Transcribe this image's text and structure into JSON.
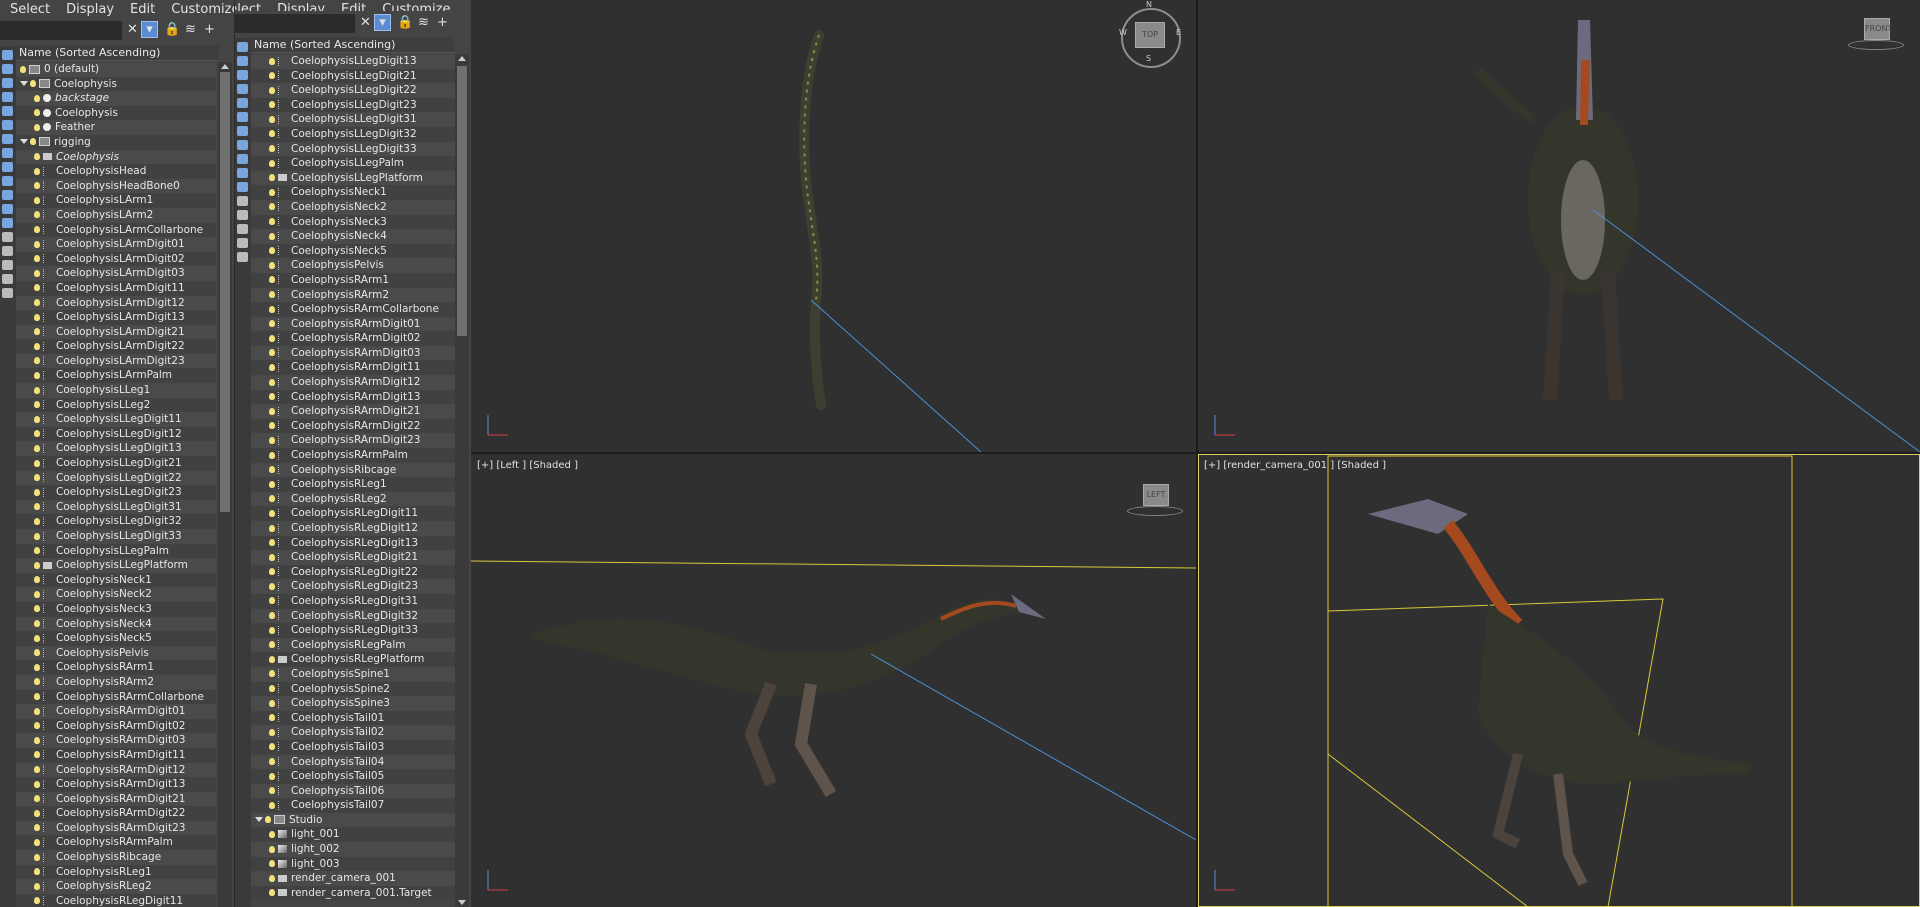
{
  "explorer1": {
    "menu": [
      "Select",
      "Display",
      "Edit",
      "Customize"
    ],
    "column_header": "Name (Sorted Ascending)",
    "rows": [
      {
        "label": "0 (default)",
        "indent": 0,
        "type": "layer",
        "arrow": false,
        "italic": false
      },
      {
        "label": "Coelophysis",
        "indent": 0,
        "type": "layer",
        "arrow": true,
        "italic": false
      },
      {
        "label": "backstage",
        "indent": 1,
        "type": "circle",
        "arrow": false,
        "italic": true
      },
      {
        "label": "Coelophysis",
        "indent": 1,
        "type": "circle",
        "arrow": false,
        "italic": false
      },
      {
        "label": "Feather",
        "indent": 1,
        "type": "circle",
        "arrow": false,
        "italic": false
      },
      {
        "label": "rigging",
        "indent": 0,
        "type": "layer",
        "arrow": true,
        "italic": false
      },
      {
        "label": "Coelophysis",
        "indent": 1,
        "type": "cam",
        "arrow": false,
        "italic": true
      },
      {
        "label": "CoelophysisHead",
        "indent": 1,
        "type": "bone",
        "arrow": false,
        "italic": false
      },
      {
        "label": "CoelophysisHeadBone0",
        "indent": 1,
        "type": "bone",
        "arrow": false,
        "italic": false
      },
      {
        "label": "CoelophysisLArm1",
        "indent": 1,
        "type": "bone",
        "arrow": false,
        "italic": false
      },
      {
        "label": "CoelophysisLArm2",
        "indent": 1,
        "type": "bone",
        "arrow": false,
        "italic": false
      },
      {
        "label": "CoelophysisLArmCollarbone",
        "indent": 1,
        "type": "bone",
        "arrow": false,
        "italic": false
      },
      {
        "label": "CoelophysisLArmDigit01",
        "indent": 1,
        "type": "bone",
        "arrow": false,
        "italic": false
      },
      {
        "label": "CoelophysisLArmDigit02",
        "indent": 1,
        "type": "bone",
        "arrow": false,
        "italic": false
      },
      {
        "label": "CoelophysisLArmDigit03",
        "indent": 1,
        "type": "bone",
        "arrow": false,
        "italic": false
      },
      {
        "label": "CoelophysisLArmDigit11",
        "indent": 1,
        "type": "bone",
        "arrow": false,
        "italic": false
      },
      {
        "label": "CoelophysisLArmDigit12",
        "indent": 1,
        "type": "bone",
        "arrow": false,
        "italic": false
      },
      {
        "label": "CoelophysisLArmDigit13",
        "indent": 1,
        "type": "bone",
        "arrow": false,
        "italic": false
      },
      {
        "label": "CoelophysisLArmDigit21",
        "indent": 1,
        "type": "bone",
        "arrow": false,
        "italic": false
      },
      {
        "label": "CoelophysisLArmDigit22",
        "indent": 1,
        "type": "bone",
        "arrow": false,
        "italic": false
      },
      {
        "label": "CoelophysisLArmDigit23",
        "indent": 1,
        "type": "bone",
        "arrow": false,
        "italic": false
      },
      {
        "label": "CoelophysisLArmPalm",
        "indent": 1,
        "type": "bone",
        "arrow": false,
        "italic": false
      },
      {
        "label": "CoelophysisLLeg1",
        "indent": 1,
        "type": "bone",
        "arrow": false,
        "italic": false
      },
      {
        "label": "CoelophysisLLeg2",
        "indent": 1,
        "type": "bone",
        "arrow": false,
        "italic": false
      },
      {
        "label": "CoelophysisLLegDigit11",
        "indent": 1,
        "type": "bone",
        "arrow": false,
        "italic": false
      },
      {
        "label": "CoelophysisLLegDigit12",
        "indent": 1,
        "type": "bone",
        "arrow": false,
        "italic": false
      },
      {
        "label": "CoelophysisLLegDigit13",
        "indent": 1,
        "type": "bone",
        "arrow": false,
        "italic": false
      },
      {
        "label": "CoelophysisLLegDigit21",
        "indent": 1,
        "type": "bone",
        "arrow": false,
        "italic": false
      },
      {
        "label": "CoelophysisLLegDigit22",
        "indent": 1,
        "type": "bone",
        "arrow": false,
        "italic": false
      },
      {
        "label": "CoelophysisLLegDigit23",
        "indent": 1,
        "type": "bone",
        "arrow": false,
        "italic": false
      },
      {
        "label": "CoelophysisLLegDigit31",
        "indent": 1,
        "type": "bone",
        "arrow": false,
        "italic": false
      },
      {
        "label": "CoelophysisLLegDigit32",
        "indent": 1,
        "type": "bone",
        "arrow": false,
        "italic": false
      },
      {
        "label": "CoelophysisLLegDigit33",
        "indent": 1,
        "type": "bone",
        "arrow": false,
        "italic": false
      },
      {
        "label": "CoelophysisLLegPalm",
        "indent": 1,
        "type": "bone",
        "arrow": false,
        "italic": false
      },
      {
        "label": "CoelophysisLLegPlatform",
        "indent": 1,
        "type": "cam",
        "arrow": false,
        "italic": false
      },
      {
        "label": "CoelophysisNeck1",
        "indent": 1,
        "type": "bone",
        "arrow": false,
        "italic": false
      },
      {
        "label": "CoelophysisNeck2",
        "indent": 1,
        "type": "bone",
        "arrow": false,
        "italic": false
      },
      {
        "label": "CoelophysisNeck3",
        "indent": 1,
        "type": "bone",
        "arrow": false,
        "italic": false
      },
      {
        "label": "CoelophysisNeck4",
        "indent": 1,
        "type": "bone",
        "arrow": false,
        "italic": false
      },
      {
        "label": "CoelophysisNeck5",
        "indent": 1,
        "type": "bone",
        "arrow": false,
        "italic": false
      },
      {
        "label": "CoelophysisPelvis",
        "indent": 1,
        "type": "bone",
        "arrow": false,
        "italic": false
      },
      {
        "label": "CoelophysisRArm1",
        "indent": 1,
        "type": "bone",
        "arrow": false,
        "italic": false
      },
      {
        "label": "CoelophysisRArm2",
        "indent": 1,
        "type": "bone",
        "arrow": false,
        "italic": false
      },
      {
        "label": "CoelophysisRArmCollarbone",
        "indent": 1,
        "type": "bone",
        "arrow": false,
        "italic": false
      },
      {
        "label": "CoelophysisRArmDigit01",
        "indent": 1,
        "type": "bone",
        "arrow": false,
        "italic": false
      },
      {
        "label": "CoelophysisRArmDigit02",
        "indent": 1,
        "type": "bone",
        "arrow": false,
        "italic": false
      },
      {
        "label": "CoelophysisRArmDigit03",
        "indent": 1,
        "type": "bone",
        "arrow": false,
        "italic": false
      },
      {
        "label": "CoelophysisRArmDigit11",
        "indent": 1,
        "type": "bone",
        "arrow": false,
        "italic": false
      },
      {
        "label": "CoelophysisRArmDigit12",
        "indent": 1,
        "type": "bone",
        "arrow": false,
        "italic": false
      },
      {
        "label": "CoelophysisRArmDigit13",
        "indent": 1,
        "type": "bone",
        "arrow": false,
        "italic": false
      },
      {
        "label": "CoelophysisRArmDigit21",
        "indent": 1,
        "type": "bone",
        "arrow": false,
        "italic": false
      },
      {
        "label": "CoelophysisRArmDigit22",
        "indent": 1,
        "type": "bone",
        "arrow": false,
        "italic": false
      },
      {
        "label": "CoelophysisRArmDigit23",
        "indent": 1,
        "type": "bone",
        "arrow": false,
        "italic": false
      },
      {
        "label": "CoelophysisRArmPalm",
        "indent": 1,
        "type": "bone",
        "arrow": false,
        "italic": false
      },
      {
        "label": "CoelophysisRibcage",
        "indent": 1,
        "type": "bone",
        "arrow": false,
        "italic": false
      },
      {
        "label": "CoelophysisRLeg1",
        "indent": 1,
        "type": "bone",
        "arrow": false,
        "italic": false
      },
      {
        "label": "CoelophysisRLeg2",
        "indent": 1,
        "type": "bone",
        "arrow": false,
        "italic": false
      },
      {
        "label": "CoelophysisRLegDigit11",
        "indent": 1,
        "type": "bone",
        "arrow": false,
        "italic": false
      }
    ]
  },
  "explorer2": {
    "menu": [
      "Select",
      "Display",
      "Edit",
      "Customize"
    ],
    "column_header": "Name (Sorted Ascending)",
    "rows": [
      {
        "label": "CoelophysisLLegDigit13",
        "indent": 1,
        "type": "bone",
        "arrow": false,
        "italic": false
      },
      {
        "label": "CoelophysisLLegDigit21",
        "indent": 1,
        "type": "bone",
        "arrow": false,
        "italic": false
      },
      {
        "label": "CoelophysisLLegDigit22",
        "indent": 1,
        "type": "bone",
        "arrow": false,
        "italic": false
      },
      {
        "label": "CoelophysisLLegDigit23",
        "indent": 1,
        "type": "bone",
        "arrow": false,
        "italic": false
      },
      {
        "label": "CoelophysisLLegDigit31",
        "indent": 1,
        "type": "bone",
        "arrow": false,
        "italic": false
      },
      {
        "label": "CoelophysisLLegDigit32",
        "indent": 1,
        "type": "bone",
        "arrow": false,
        "italic": false
      },
      {
        "label": "CoelophysisLLegDigit33",
        "indent": 1,
        "type": "bone",
        "arrow": false,
        "italic": false
      },
      {
        "label": "CoelophysisLLegPalm",
        "indent": 1,
        "type": "bone",
        "arrow": false,
        "italic": false
      },
      {
        "label": "CoelophysisLLegPlatform",
        "indent": 1,
        "type": "cam",
        "arrow": false,
        "italic": false
      },
      {
        "label": "CoelophysisNeck1",
        "indent": 1,
        "type": "bone",
        "arrow": false,
        "italic": false
      },
      {
        "label": "CoelophysisNeck2",
        "indent": 1,
        "type": "bone",
        "arrow": false,
        "italic": false
      },
      {
        "label": "CoelophysisNeck3",
        "indent": 1,
        "type": "bone",
        "arrow": false,
        "italic": false
      },
      {
        "label": "CoelophysisNeck4",
        "indent": 1,
        "type": "bone",
        "arrow": false,
        "italic": false
      },
      {
        "label": "CoelophysisNeck5",
        "indent": 1,
        "type": "bone",
        "arrow": false,
        "italic": false
      },
      {
        "label": "CoelophysisPelvis",
        "indent": 1,
        "type": "bone",
        "arrow": false,
        "italic": false
      },
      {
        "label": "CoelophysisRArm1",
        "indent": 1,
        "type": "bone",
        "arrow": false,
        "italic": false
      },
      {
        "label": "CoelophysisRArm2",
        "indent": 1,
        "type": "bone",
        "arrow": false,
        "italic": false
      },
      {
        "label": "CoelophysisRArmCollarbone",
        "indent": 1,
        "type": "bone",
        "arrow": false,
        "italic": false
      },
      {
        "label": "CoelophysisRArmDigit01",
        "indent": 1,
        "type": "bone",
        "arrow": false,
        "italic": false
      },
      {
        "label": "CoelophysisRArmDigit02",
        "indent": 1,
        "type": "bone",
        "arrow": false,
        "italic": false
      },
      {
        "label": "CoelophysisRArmDigit03",
        "indent": 1,
        "type": "bone",
        "arrow": false,
        "italic": false
      },
      {
        "label": "CoelophysisRArmDigit11",
        "indent": 1,
        "type": "bone",
        "arrow": false,
        "italic": false
      },
      {
        "label": "CoelophysisRArmDigit12",
        "indent": 1,
        "type": "bone",
        "arrow": false,
        "italic": false
      },
      {
        "label": "CoelophysisRArmDigit13",
        "indent": 1,
        "type": "bone",
        "arrow": false,
        "italic": false
      },
      {
        "label": "CoelophysisRArmDigit21",
        "indent": 1,
        "type": "bone",
        "arrow": false,
        "italic": false
      },
      {
        "label": "CoelophysisRArmDigit22",
        "indent": 1,
        "type": "bone",
        "arrow": false,
        "italic": false
      },
      {
        "label": "CoelophysisRArmDigit23",
        "indent": 1,
        "type": "bone",
        "arrow": false,
        "italic": false
      },
      {
        "label": "CoelophysisRArmPalm",
        "indent": 1,
        "type": "bone",
        "arrow": false,
        "italic": false
      },
      {
        "label": "CoelophysisRibcage",
        "indent": 1,
        "type": "bone",
        "arrow": false,
        "italic": false
      },
      {
        "label": "CoelophysisRLeg1",
        "indent": 1,
        "type": "bone",
        "arrow": false,
        "italic": false
      },
      {
        "label": "CoelophysisRLeg2",
        "indent": 1,
        "type": "bone",
        "arrow": false,
        "italic": false
      },
      {
        "label": "CoelophysisRLegDigit11",
        "indent": 1,
        "type": "bone",
        "arrow": false,
        "italic": false
      },
      {
        "label": "CoelophysisRLegDigit12",
        "indent": 1,
        "type": "bone",
        "arrow": false,
        "italic": false
      },
      {
        "label": "CoelophysisRLegDigit13",
        "indent": 1,
        "type": "bone",
        "arrow": false,
        "italic": false
      },
      {
        "label": "CoelophysisRLegDigit21",
        "indent": 1,
        "type": "bone",
        "arrow": false,
        "italic": false
      },
      {
        "label": "CoelophysisRLegDigit22",
        "indent": 1,
        "type": "bone",
        "arrow": false,
        "italic": false
      },
      {
        "label": "CoelophysisRLegDigit23",
        "indent": 1,
        "type": "bone",
        "arrow": false,
        "italic": false
      },
      {
        "label": "CoelophysisRLegDigit31",
        "indent": 1,
        "type": "bone",
        "arrow": false,
        "italic": false
      },
      {
        "label": "CoelophysisRLegDigit32",
        "indent": 1,
        "type": "bone",
        "arrow": false,
        "italic": false
      },
      {
        "label": "CoelophysisRLegDigit33",
        "indent": 1,
        "type": "bone",
        "arrow": false,
        "italic": false
      },
      {
        "label": "CoelophysisRLegPalm",
        "indent": 1,
        "type": "bone",
        "arrow": false,
        "italic": false
      },
      {
        "label": "CoelophysisRLegPlatform",
        "indent": 1,
        "type": "cam",
        "arrow": false,
        "italic": false
      },
      {
        "label": "CoelophysisSpine1",
        "indent": 1,
        "type": "bone",
        "arrow": false,
        "italic": false
      },
      {
        "label": "CoelophysisSpine2",
        "indent": 1,
        "type": "bone",
        "arrow": false,
        "italic": false
      },
      {
        "label": "CoelophysisSpine3",
        "indent": 1,
        "type": "bone",
        "arrow": false,
        "italic": false
      },
      {
        "label": "CoelophysisTail01",
        "indent": 1,
        "type": "bone",
        "arrow": false,
        "italic": false
      },
      {
        "label": "CoelophysisTail02",
        "indent": 1,
        "type": "bone",
        "arrow": false,
        "italic": false
      },
      {
        "label": "CoelophysisTail03",
        "indent": 1,
        "type": "bone",
        "arrow": false,
        "italic": false
      },
      {
        "label": "CoelophysisTail04",
        "indent": 1,
        "type": "bone",
        "arrow": false,
        "italic": false
      },
      {
        "label": "CoelophysisTail05",
        "indent": 1,
        "type": "bone",
        "arrow": false,
        "italic": false
      },
      {
        "label": "CoelophysisTail06",
        "indent": 1,
        "type": "bone",
        "arrow": false,
        "italic": false
      },
      {
        "label": "CoelophysisTail07",
        "indent": 1,
        "type": "bone",
        "arrow": false,
        "italic": false
      },
      {
        "label": "Studio",
        "indent": 0,
        "type": "layer",
        "arrow": true,
        "italic": false
      },
      {
        "label": "light_001",
        "indent": 1,
        "type": "light",
        "arrow": false,
        "italic": false
      },
      {
        "label": "light_002",
        "indent": 1,
        "type": "light",
        "arrow": false,
        "italic": false
      },
      {
        "label": "light_003",
        "indent": 1,
        "type": "light",
        "arrow": false,
        "italic": false
      },
      {
        "label": "render_camera_001",
        "indent": 1,
        "type": "cam",
        "arrow": false,
        "italic": false
      },
      {
        "label": "render_camera_001.Target",
        "indent": 1,
        "type": "cam",
        "arrow": false,
        "italic": false
      }
    ]
  },
  "viewports": {
    "top": {
      "navcube": "TOP",
      "compass": [
        "N",
        "E",
        "S",
        "W"
      ]
    },
    "front": {
      "navcube": "FRONT"
    },
    "left": {
      "label": "[+] [Left ] [Shaded ]",
      "navcube": "LEFT"
    },
    "camera": {
      "label": "[+] [render_camera_001 ] [Shaded ]"
    }
  },
  "colors": {
    "selection_line": "#4a90d9",
    "camera_frustum": "#d8c93a",
    "bulb": "#f2e07a"
  }
}
